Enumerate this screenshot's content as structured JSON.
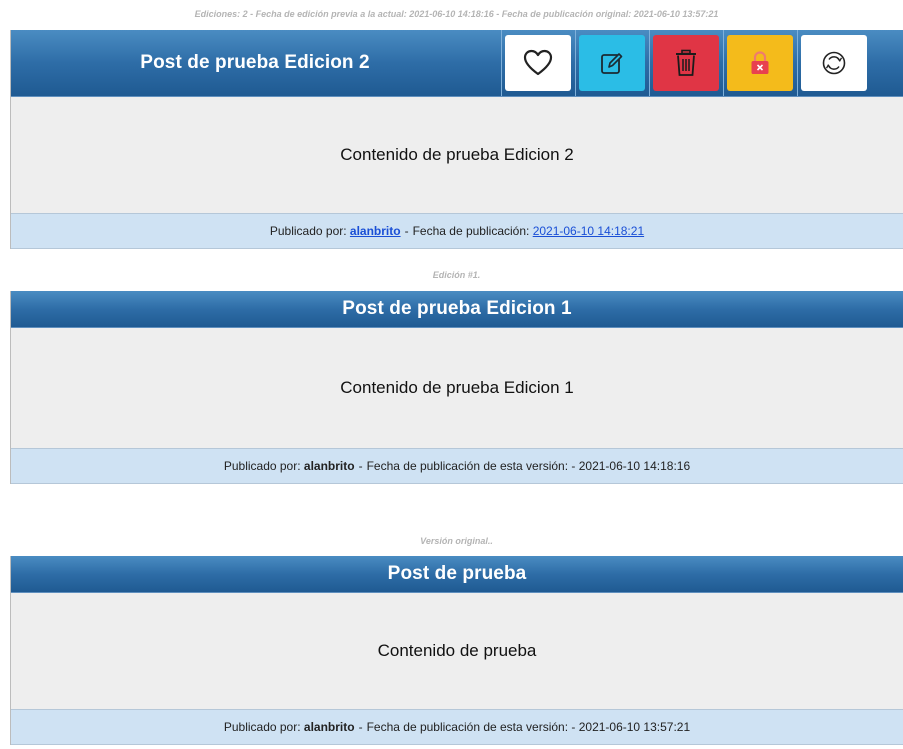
{
  "current": {
    "meta": "Ediciones: 2 - Fecha de edición previa a la actual: 2021-06-10 14:18:16 - Fecha de publicación original: 2021-06-10 13:57:21",
    "title": "Post de prueba Edicion 2",
    "content": "Contenido de prueba Edicion 2",
    "published_by_label": "Publicado por:",
    "author": "alanbrito",
    "separator": "-",
    "date_label": "Fecha de publicación:",
    "date": "2021-06-10 14:18:21",
    "actions": [
      {
        "name": "like",
        "icon": "heart-icon"
      },
      {
        "name": "edit",
        "icon": "pencil-square-icon"
      },
      {
        "name": "delete",
        "icon": "trash-icon"
      },
      {
        "name": "lock",
        "icon": "lock-icon"
      },
      {
        "name": "history",
        "icon": "history-icon"
      }
    ]
  },
  "edit1": {
    "meta": "Edición #1.",
    "title": "Post de prueba Edicion 1",
    "content": "Contenido de prueba Edicion 1",
    "published_by_label": "Publicado por:",
    "author": "alanbrito",
    "separator": "-",
    "date_label": "Fecha de publicación de esta versión: -",
    "date": "2021-06-10 14:18:16"
  },
  "original": {
    "meta": "Versión original..",
    "title": "Post de prueba",
    "content": "Contenido de prueba",
    "published_by_label": "Publicado por:",
    "author": "alanbrito",
    "separator": "-",
    "date_label": "Fecha de publicación de esta versión: -",
    "date": "2021-06-10 13:57:21"
  },
  "colors": {
    "header_blue": "#2e6da7",
    "body_gray": "#eeeeee",
    "footer_blue": "#cfe2f3",
    "edit_cyan": "#2bbde6",
    "delete_red": "#e03545",
    "lock_yellow": "#f4bb1b",
    "link_blue": "#1a4fd6"
  }
}
